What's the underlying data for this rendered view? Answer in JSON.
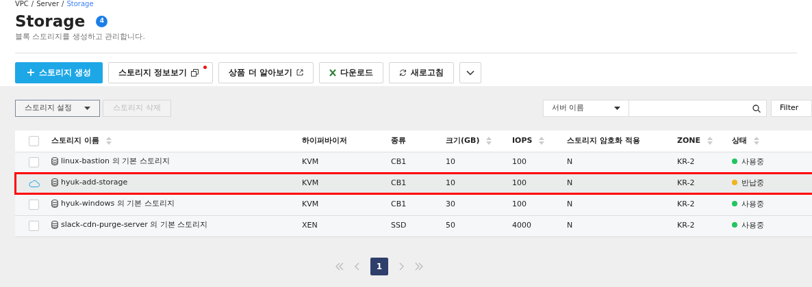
{
  "breadcrumb": [
    {
      "label": "VPC",
      "selected": false
    },
    {
      "label": "Server",
      "selected": false
    },
    {
      "label": "Storage",
      "selected": true
    }
  ],
  "title": "Storage",
  "count": "4",
  "subtitle": "블록 스토리지를 생성하고 관리합니다.",
  "breadcrumb_separator": "/",
  "actions": [
    {
      "kind": "create",
      "label": "스토리지 생성"
    },
    {
      "kind": "info",
      "label": "스토리지 정보보기",
      "notify": true
    },
    {
      "kind": "learn",
      "label": "상품 더 알아보기"
    },
    {
      "kind": "download",
      "label": "다운로드"
    },
    {
      "kind": "refresh",
      "label": "새로고침"
    },
    {
      "kind": "more"
    }
  ],
  "toolbar": {
    "settings": {
      "label": "스토리지 설정",
      "disabled": false
    },
    "delete": {
      "label": "스토리지 삭제",
      "disabled": true
    },
    "search_by": "서버 이름",
    "filter": "Filter"
  },
  "table": {
    "select_all_checked": false,
    "columns": [
      {
        "label": "스토리지 이름",
        "sortable": true
      },
      {
        "label": "하이퍼바이저",
        "sortable": false
      },
      {
        "label": "종류",
        "sortable": false
      },
      {
        "label": "크기(GB)",
        "sortable": true
      },
      {
        "label": "IOPS",
        "sortable": true
      },
      {
        "label": "스토리지 암호화 적용",
        "sortable": false
      },
      {
        "label": "ZONE",
        "sortable": true
      },
      {
        "label": "상태",
        "sortable": true
      }
    ],
    "rows": [
      {
        "kind": "checkbox",
        "checked": false,
        "highlighted": false,
        "cells": [
          "linux-bastion 의 기본 스토리지",
          "KVM",
          "CB1",
          "10",
          "100",
          "N",
          "KR-2",
          "사용중"
        ],
        "color": "#22c55e"
      },
      {
        "kind": "pending",
        "highlighted": true,
        "cells": [
          "hyuk-add-storage",
          "KVM",
          "CB1",
          "10",
          "100",
          "N",
          "KR-2",
          "반납중"
        ],
        "color": "#f0b41e"
      },
      {
        "kind": "checkbox",
        "checked": false,
        "highlighted": false,
        "cells": [
          "hyuk-windows 의 기본 스토리지",
          "KVM",
          "CB1",
          "30",
          "100",
          "N",
          "KR-2",
          "사용중"
        ],
        "color": "#22c55e"
      },
      {
        "kind": "checkbox",
        "checked": false,
        "highlighted": false,
        "cells": [
          "slack-cdn-purge-server 의 기본 스토리지",
          "XEN",
          "SSD",
          "50",
          "4000",
          "N",
          "KR-2",
          "사용중"
        ],
        "color": "#22c55e"
      }
    ]
  },
  "pagination": {
    "pages": [
      {
        "label": "1",
        "selected": true
      }
    ]
  }
}
